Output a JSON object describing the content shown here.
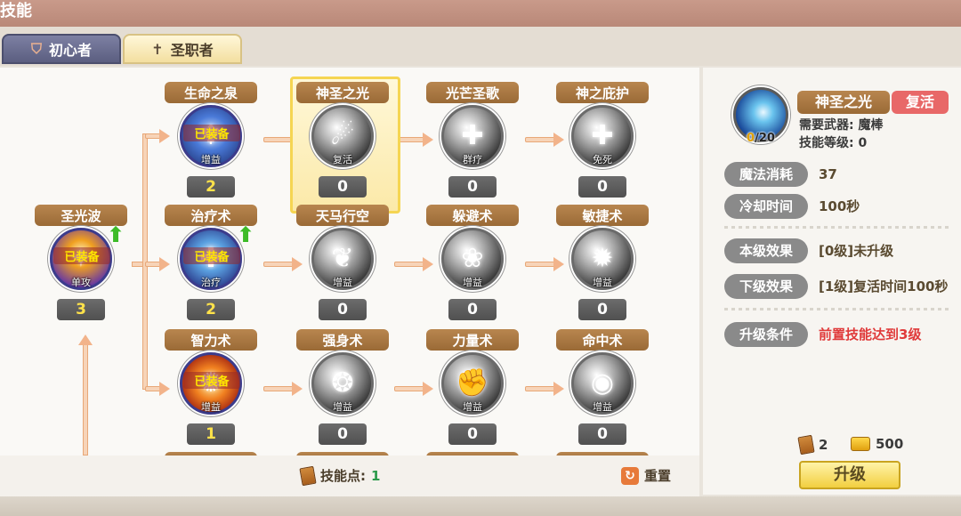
{
  "window": {
    "title": "技能"
  },
  "tabs": [
    {
      "label": "初心者",
      "icon": "shield-icon"
    },
    {
      "label": "圣职者",
      "icon": "cross-icon"
    }
  ],
  "skills": {
    "shengguangbo": {
      "name": "圣光波",
      "type": "单攻",
      "level": "3",
      "equipped": "已装备"
    },
    "shengmingzhiquan": {
      "name": "生命之泉",
      "type": "增益",
      "level": "2",
      "equipped": "已装备"
    },
    "zhiliaoshu": {
      "name": "治疗术",
      "type": "治疗",
      "level": "2",
      "equipped": "已装备"
    },
    "zhilishu": {
      "name": "智力术",
      "type": "增益",
      "level": "1",
      "equipped": "已装备"
    },
    "shenshengzhiguang": {
      "name": "神圣之光",
      "type": "复活",
      "level": "0"
    },
    "tianmaxingkong": {
      "name": "天马行空",
      "type": "增益",
      "level": "0"
    },
    "qiangshenshu": {
      "name": "强身术",
      "type": "增益",
      "level": "0"
    },
    "guangmangshengge": {
      "name": "光芒圣歌",
      "type": "群疗",
      "level": "0"
    },
    "duobishu": {
      "name": "躲避术",
      "type": "增益",
      "level": "0"
    },
    "liliangshu": {
      "name": "力量术",
      "type": "增益",
      "level": "0"
    },
    "shenzhibihu": {
      "name": "神之庇护",
      "type": "免死",
      "level": "0"
    },
    "minjieshu": {
      "name": "敏捷术",
      "type": "增益",
      "level": "0"
    },
    "mingzhongshu": {
      "name": "命中术",
      "type": "增益",
      "level": "0"
    }
  },
  "bottom": {
    "points_label": "技能点:",
    "points_value": "1",
    "reset_label": "重置"
  },
  "detail": {
    "name": "神圣之光",
    "tag": "复活",
    "level_current": "0",
    "level_max": "/20",
    "weapon_line": "需要武器: 魔棒",
    "skill_level_line": "技能等级: 0",
    "stats": [
      {
        "label": "魔法消耗",
        "value": "37"
      },
      {
        "label": "冷却时间",
        "value": "100秒"
      },
      {
        "label": "本级效果",
        "value": "[0级]未升级"
      },
      {
        "label": "下级效果",
        "value": "[1级]复活时间100秒"
      },
      {
        "label": "升级条件",
        "value": "前置技能达到3级"
      }
    ],
    "resources": {
      "books": "2",
      "gold": "500"
    },
    "upgrade_label": "升级"
  }
}
